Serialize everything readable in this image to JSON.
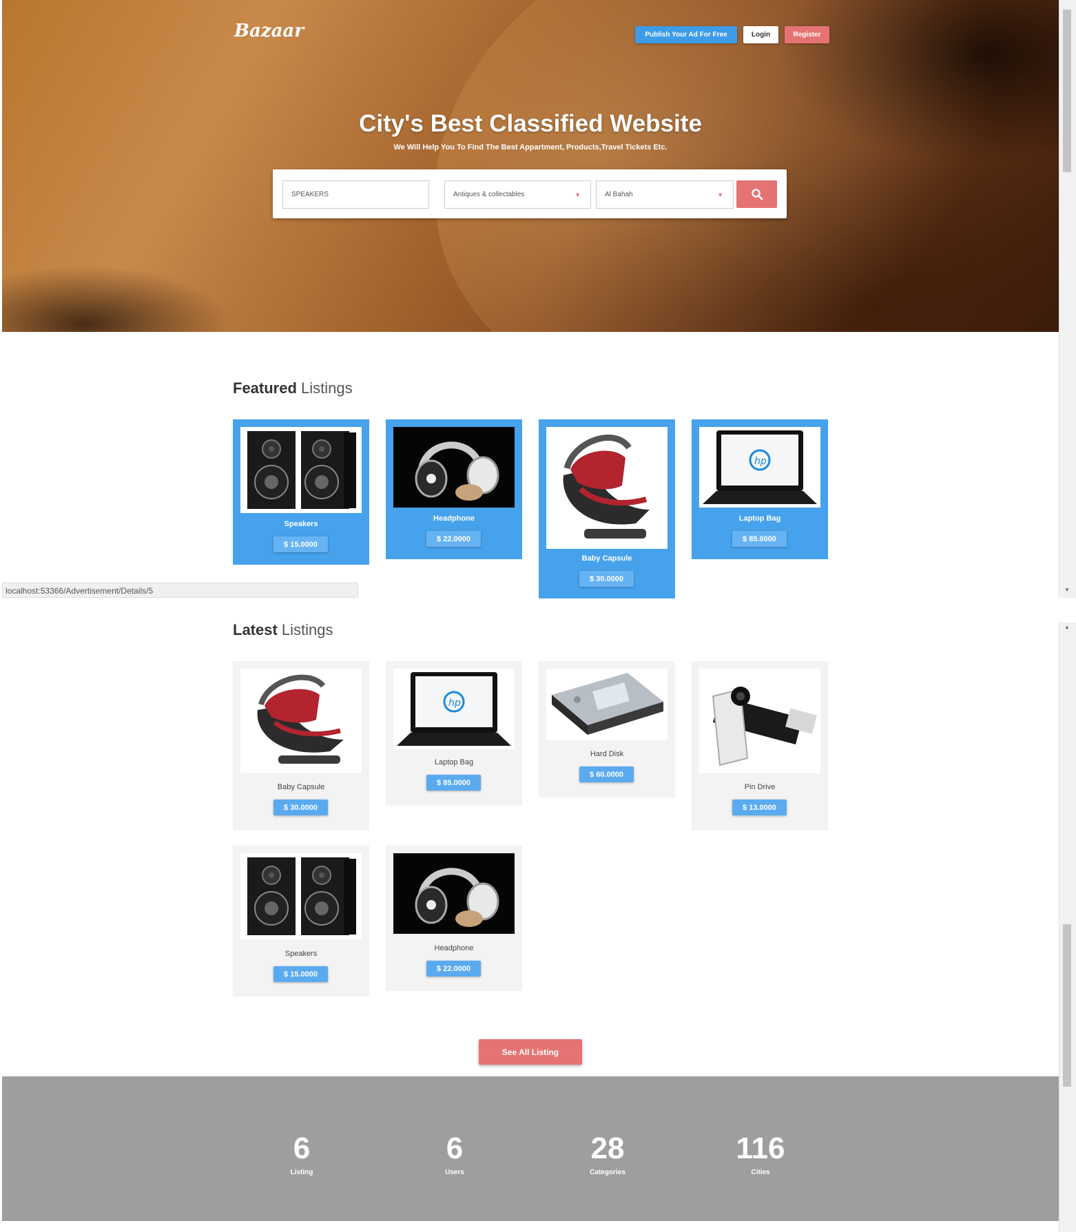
{
  "header": {
    "logo": "Bazaar",
    "publish_label": "Publish Your Ad For Free",
    "login_label": "Login",
    "register_label": "Register"
  },
  "hero": {
    "title": "City's Best Classified Website",
    "subtitle": "We Will Help You To Find The Best Appartment, Products,Travel Tickets Etc."
  },
  "search": {
    "keyword_value": "SPEAKERS",
    "category_value": "Antiques & collectables",
    "city_value": "Al Bahah"
  },
  "featured": {
    "title_bold": "Featured",
    "title_rest": " Listings",
    "items": [
      {
        "name": "Speakers",
        "price": "$ 15.0000",
        "icon": "speakers-image"
      },
      {
        "name": "Headphone",
        "price": "$ 22.0000",
        "icon": "headphone-image"
      },
      {
        "name": "Baby Capsule",
        "price": "$ 30.0000",
        "icon": "baby-capsule-image"
      },
      {
        "name": "Laptop Bag",
        "price": "$ 85.0000",
        "icon": "laptop-image"
      }
    ]
  },
  "status_bar": {
    "url": "localhost:53366/Advertisement/Details/5"
  },
  "latest": {
    "title_bold": "Latest",
    "title_rest": " Listings",
    "items": [
      {
        "name": "Baby Capsule",
        "price": "$ 30.0000",
        "icon": "baby-capsule-image"
      },
      {
        "name": "Laptop Bag",
        "price": "$ 85.0000",
        "icon": "laptop-image"
      },
      {
        "name": "Hard Disk",
        "price": "$ 60.0000",
        "icon": "hard-disk-image"
      },
      {
        "name": "Pin Drive",
        "price": "$ 13.0000",
        "icon": "pin-drive-image"
      },
      {
        "name": "Speakers",
        "price": "$ 15.0000",
        "icon": "speakers-image"
      },
      {
        "name": "Headphone",
        "price": "$ 22.0000",
        "icon": "headphone-image"
      }
    ],
    "see_all_label": "See All Listing"
  },
  "stats": [
    {
      "value": "6",
      "label": "Listing"
    },
    {
      "value": "6",
      "label": "Users"
    },
    {
      "value": "28",
      "label": "Categories"
    },
    {
      "value": "116",
      "label": "Cities"
    }
  ],
  "colors": {
    "primary_blue": "#46a2ec",
    "accent_red": "#e57373",
    "stats_gray": "#9e9e9e"
  }
}
